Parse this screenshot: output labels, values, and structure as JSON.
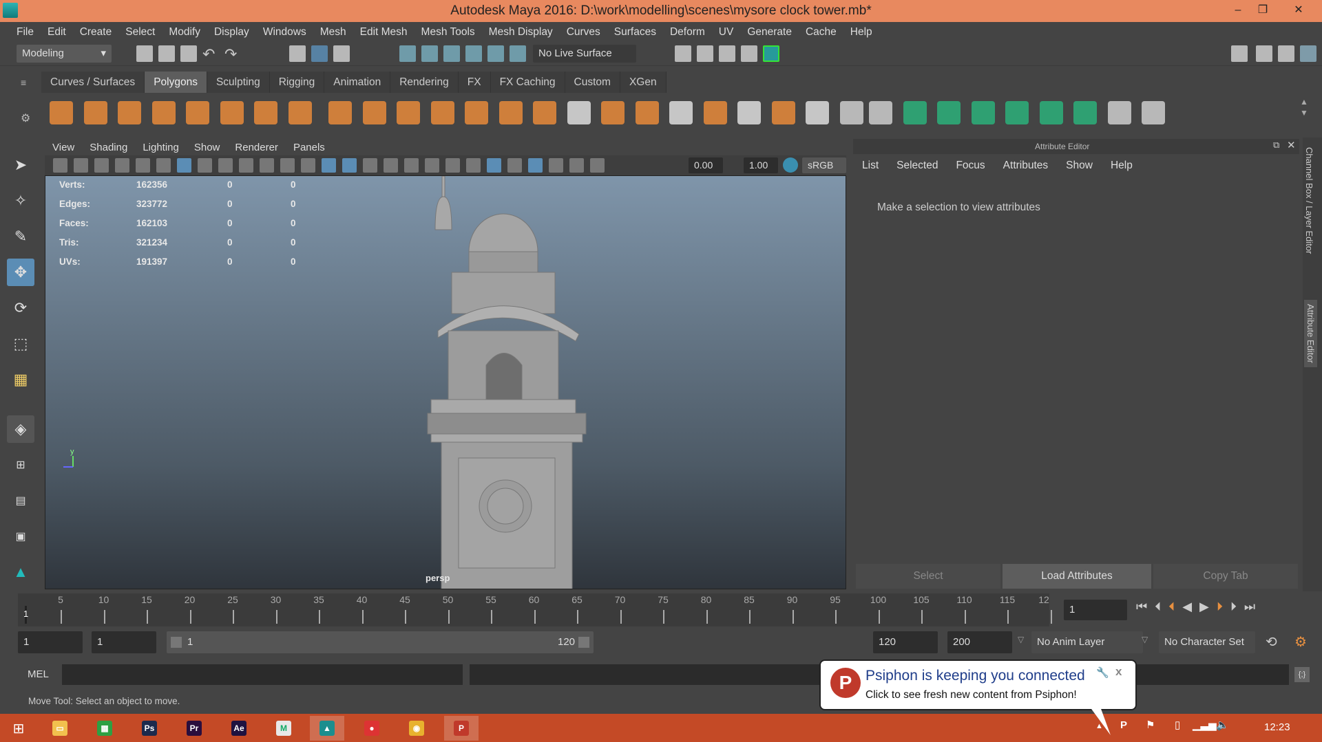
{
  "window": {
    "title": "Autodesk Maya 2016: D:\\work\\modelling\\scenes\\mysore clock tower.mb*",
    "min": "–",
    "max": "❐",
    "close": "✕"
  },
  "menu": [
    "File",
    "Edit",
    "Create",
    "Select",
    "Modify",
    "Display",
    "Windows",
    "Mesh",
    "Edit Mesh",
    "Mesh Tools",
    "Mesh Display",
    "Curves",
    "Surfaces",
    "Deform",
    "UV",
    "Generate",
    "Cache",
    "Help"
  ],
  "toolbar": {
    "mode": "Modeling",
    "live_surface": "No Live Surface"
  },
  "shelf": {
    "tabs": [
      "Curves / Surfaces",
      "Polygons",
      "Sculpting",
      "Rigging",
      "Animation",
      "Rendering",
      "FX",
      "FX Caching",
      "Custom",
      "XGen"
    ],
    "active": "Polygons",
    "icons": [
      "poly-sphere-icon",
      "poly-cube-icon",
      "poly-cylinder-icon",
      "poly-cone-icon",
      "poly-plane-icon",
      "poly-torus-icon",
      "poly-pyramid-icon",
      "poly-pipe-icon",
      "combine-icon",
      "separate-icon",
      "extract-icon",
      "smooth-icon",
      "bevel-icon",
      "bridge-icon",
      "append-icon",
      "insert-edge-loop-icon",
      "multi-cut-icon",
      "extrude-icon",
      "target-weld-icon",
      "sculpt-icon",
      "merge-icon",
      "fill-hole-icon",
      "quadrangulate-icon",
      "triangulate-icon",
      "mirror-icon",
      "uv-planar-icon",
      "uv-cylindrical-icon",
      "uv-spherical-icon",
      "uv-automatic-icon",
      "uv-editor-icon",
      "uv-unfold-icon",
      "uv-layout-icon",
      "uv-cut-icon"
    ]
  },
  "viewport": {
    "menu": [
      "View",
      "Shading",
      "Lighting",
      "Show",
      "Renderer",
      "Panels"
    ],
    "exposure": "0.00",
    "gamma": "1.00",
    "color_space": "sRGB ga",
    "camera": "persp",
    "axis_y": "y",
    "stats": [
      {
        "label": "Verts:",
        "v": "162356",
        "a": "0",
        "b": "0"
      },
      {
        "label": "Edges:",
        "v": "323772",
        "a": "0",
        "b": "0"
      },
      {
        "label": "Faces:",
        "v": "162103",
        "a": "0",
        "b": "0"
      },
      {
        "label": "Tris:",
        "v": "321234",
        "a": "0",
        "b": "0"
      },
      {
        "label": "UVs:",
        "v": "191397",
        "a": "0",
        "b": "0"
      }
    ]
  },
  "attribute_editor": {
    "title": "Attribute Editor",
    "menu": [
      "List",
      "Selected",
      "Focus",
      "Attributes",
      "Show",
      "Help"
    ],
    "message": "Make a selection to view attributes",
    "select": "Select",
    "load": "Load Attributes",
    "copy": "Copy Tab"
  },
  "side_tabs": {
    "channel_box": "Channel Box / Layer Editor",
    "attribute_editor": "Attribute Editor"
  },
  "timeline": {
    "ticks": [
      "5",
      "10",
      "15",
      "20",
      "25",
      "30",
      "35",
      "40",
      "45",
      "50",
      "55",
      "60",
      "65",
      "70",
      "75",
      "80",
      "85",
      "90",
      "95",
      "100",
      "105",
      "110",
      "115",
      "12"
    ],
    "current_marker": "1",
    "current_frame": "1"
  },
  "range": {
    "start": "1",
    "anim_start": "1",
    "slider_start": "1",
    "slider_end": "120",
    "end": "120",
    "anim_end": "200",
    "anim_layer": "No Anim Layer",
    "character_set": "No Character Set"
  },
  "mel": {
    "label": "MEL"
  },
  "help_line": "Move Tool: Select an object to move.",
  "popup": {
    "title": "Psiphon is keeping you connected",
    "body": "Click to see fresh new content from Psiphon!",
    "close": "x"
  },
  "taskbar": {
    "clock": "12:23",
    "apps": [
      {
        "name": "file-explorer",
        "label": "▭",
        "color": "#f2c14e"
      },
      {
        "name": "store",
        "label": "▦",
        "color": "#2ea043"
      },
      {
        "name": "photoshop",
        "label": "Ps",
        "color": "#1c2a4d"
      },
      {
        "name": "premiere",
        "label": "Pr",
        "color": "#2a0e3d"
      },
      {
        "name": "after-effects",
        "label": "Ae",
        "color": "#1f1240"
      },
      {
        "name": "mudbox",
        "label": "M",
        "color": "#e8e8e8"
      },
      {
        "name": "maya",
        "label": "▲",
        "color": "#1c8e8e"
      },
      {
        "name": "app-red",
        "label": "●",
        "color": "#d33"
      },
      {
        "name": "chrome",
        "label": "◉",
        "color": "#e8b22e"
      },
      {
        "name": "psiphon",
        "label": "P",
        "color": "#c0392b"
      }
    ]
  }
}
